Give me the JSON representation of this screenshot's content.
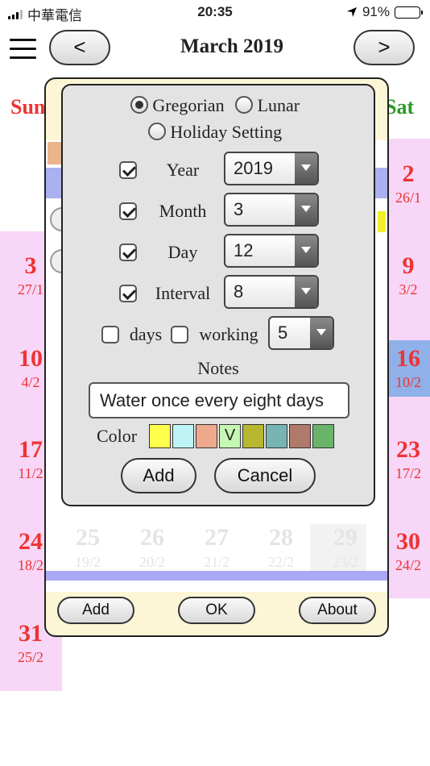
{
  "status_bar": {
    "carrier": "中華電信",
    "time": "20:35",
    "battery_text": "91%",
    "battery_level": 0.91
  },
  "header": {
    "prev_label": "<",
    "title": "March 2019",
    "next_label": ">"
  },
  "calendar": {
    "sunday_label": "Sun",
    "saturday_label": "Sat",
    "sunday_column": [
      {
        "day": "3",
        "lunar": "27/1"
      },
      {
        "day": "10",
        "lunar": "4/2"
      },
      {
        "day": "17",
        "lunar": "11/2"
      },
      {
        "day": "24",
        "lunar": "18/2"
      },
      {
        "day": "31",
        "lunar": "25/2"
      }
    ],
    "saturday_column": [
      {
        "day": "2",
        "lunar": "26/1"
      },
      {
        "day": "9",
        "lunar": "3/2"
      },
      {
        "day": "16",
        "lunar": "10/2"
      },
      {
        "day": "23",
        "lunar": "17/2"
      },
      {
        "day": "30",
        "lunar": "24/2"
      }
    ],
    "faint_row": [
      {
        "day": "25",
        "lunar": "19/2"
      },
      {
        "day": "26",
        "lunar": "20/2"
      },
      {
        "day": "27",
        "lunar": "21/2"
      },
      {
        "day": "28",
        "lunar": "22/2"
      },
      {
        "day": "29",
        "lunar": "23/2"
      }
    ],
    "highlight_color": "#8fb0e8"
  },
  "panel_buttons": {
    "add": "Add",
    "ok": "OK",
    "about": "About"
  },
  "dialog": {
    "radio_gregorian": "Gregorian",
    "radio_lunar": "Lunar",
    "radio_holiday": "Holiday Setting",
    "selected_calendar": "Gregorian",
    "year_label": "Year",
    "year_value": "2019",
    "month_label": "Month",
    "month_value": "3",
    "day_label": "Day",
    "day_value": "12",
    "interval_label": "Interval",
    "interval_value": "8",
    "days_label": "days",
    "working_label": "working",
    "working_value": "5",
    "notes_label": "Notes",
    "notes_value": "Water once every eight days",
    "color_label": "Color",
    "colors": [
      {
        "hex": "#ffff4d",
        "mark": ""
      },
      {
        "hex": "#bff4f6",
        "mark": ""
      },
      {
        "hex": "#eea88c",
        "mark": ""
      },
      {
        "hex": "#c6f7b4",
        "mark": "V"
      },
      {
        "hex": "#b8b830",
        "mark": ""
      },
      {
        "hex": "#78b4b4",
        "mark": ""
      },
      {
        "hex": "#b07a6a",
        "mark": ""
      },
      {
        "hex": "#6ab46a",
        "mark": ""
      }
    ],
    "add_label": "Add",
    "cancel_label": "Cancel"
  }
}
